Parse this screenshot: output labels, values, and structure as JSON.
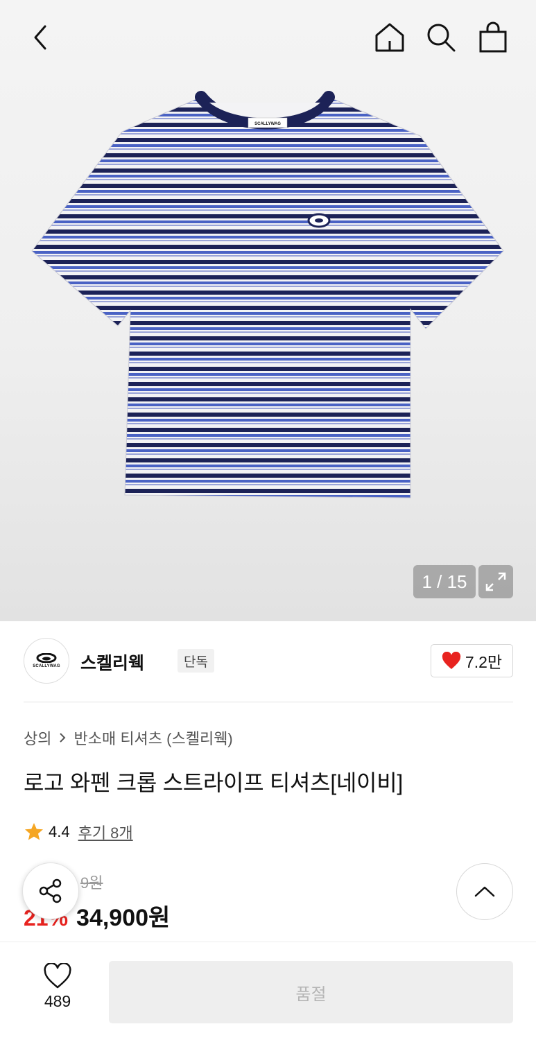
{
  "topbar": {
    "back_icon": "chevron-left-icon",
    "home_icon": "home-icon",
    "search_icon": "search-icon",
    "bag_icon": "shopping-bag-icon"
  },
  "gallery": {
    "counter": "1 / 15",
    "expand_icon": "expand-icon",
    "shirt_label": "SCALLYWAG",
    "colors": {
      "navy": "#1c2257",
      "blue": "#4a62c4",
      "white": "#f3f3f5"
    }
  },
  "brand": {
    "logo_text": "SCALLYWAG",
    "name": "스켈리웩",
    "badge": "단독",
    "likes": "7.2만"
  },
  "breadcrumb": {
    "category": "상의",
    "subcategory": "반소매 티셔츠 (스켈리웩)"
  },
  "product": {
    "title": "로고 와펜 크롭 스트라이프 티셔츠[네이비]",
    "rating": "4.4",
    "reviews": "후기 8개",
    "original_price_visible": "9원",
    "discount_visible": "21%",
    "price": "34,900원"
  },
  "bottom": {
    "wish_count": "489",
    "soldout_label": "품절"
  },
  "accent": {
    "red": "#e8231f",
    "star": "#f5a623"
  }
}
